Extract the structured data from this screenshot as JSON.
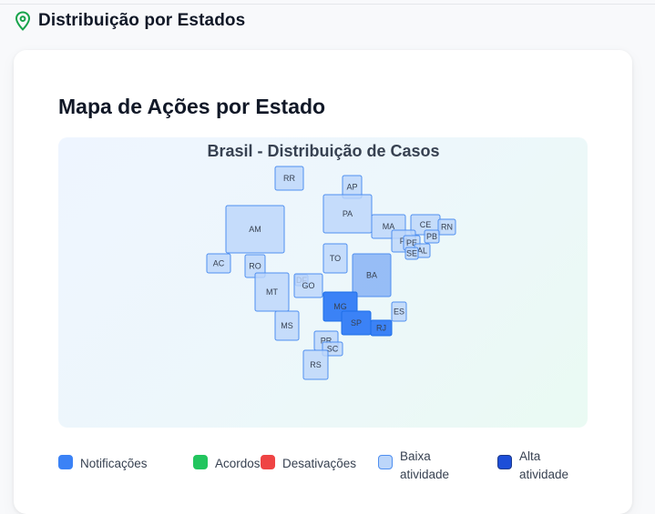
{
  "section": {
    "title": "Distribuição por Estados",
    "icon": "map-pin-icon",
    "icon_color": "#16a34a"
  },
  "card": {
    "title": "Mapa de Ações por Estado"
  },
  "map": {
    "title": "Brasil - Distribuição de Casos",
    "colors": {
      "low_fill": "#bcd6fa",
      "low_stroke": "#4f8ff0",
      "mid_fill": "#8db6f5",
      "high_fill": "#3b82f6",
      "high_stroke": "#1d6fe8",
      "label": "#374151"
    },
    "states": [
      {
        "code": "RR",
        "level": "low"
      },
      {
        "code": "AP",
        "level": "low"
      },
      {
        "code": "AM",
        "level": "low"
      },
      {
        "code": "PA",
        "level": "low"
      },
      {
        "code": "MA",
        "level": "low"
      },
      {
        "code": "CE",
        "level": "low"
      },
      {
        "code": "RN",
        "level": "low"
      },
      {
        "code": "PB",
        "level": "low"
      },
      {
        "code": "PI",
        "level": "low"
      },
      {
        "code": "PE",
        "level": "low"
      },
      {
        "code": "AL",
        "level": "low"
      },
      {
        "code": "SE",
        "level": "low"
      },
      {
        "code": "AC",
        "level": "low"
      },
      {
        "code": "RO",
        "level": "low"
      },
      {
        "code": "TO",
        "level": "low"
      },
      {
        "code": "BA",
        "level": "mid"
      },
      {
        "code": "MT",
        "level": "low"
      },
      {
        "code": "DF",
        "level": "low"
      },
      {
        "code": "GO",
        "level": "low"
      },
      {
        "code": "MG",
        "level": "high"
      },
      {
        "code": "ES",
        "level": "low"
      },
      {
        "code": "SP",
        "level": "high"
      },
      {
        "code": "RJ",
        "level": "high"
      },
      {
        "code": "MS",
        "level": "low"
      },
      {
        "code": "PR",
        "level": "low"
      },
      {
        "code": "SC",
        "level": "low"
      },
      {
        "code": "RS",
        "level": "low"
      }
    ]
  },
  "legend": [
    {
      "label": "Notificações",
      "color": "#3b82f6",
      "border": "#3b82f6"
    },
    {
      "label": "Acordos",
      "color": "#22c55e",
      "border": "#22c55e"
    },
    {
      "label": "Desativações",
      "color": "#ef4444",
      "border": "#ef4444"
    },
    {
      "label": "Baixa atividade",
      "color": "#bcd6fa",
      "border": "#4f8ff0"
    },
    {
      "label": "Alta atividade",
      "color": "#1d4ed8",
      "border": "#1e3a8a"
    }
  ]
}
